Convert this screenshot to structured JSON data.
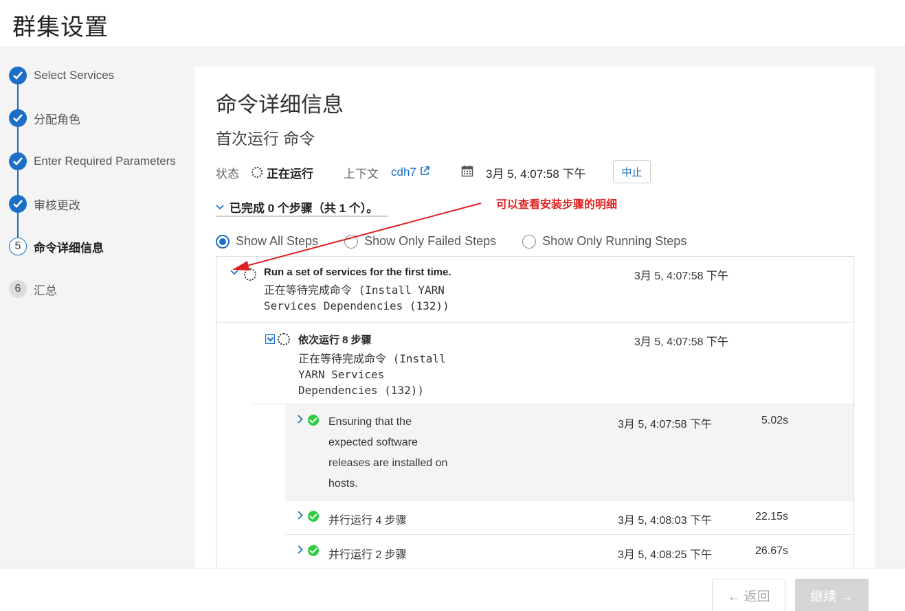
{
  "page_title": "群集设置",
  "wizard": {
    "steps": [
      {
        "label": "Select Services",
        "state": "done",
        "marker": ""
      },
      {
        "label": "分配角色",
        "state": "done",
        "marker": ""
      },
      {
        "label": "Enter Required Parameters",
        "state": "done",
        "marker": ""
      },
      {
        "label": "审核更改",
        "state": "done",
        "marker": ""
      },
      {
        "label": "命令详细信息",
        "state": "current",
        "marker": "5"
      },
      {
        "label": "汇总",
        "state": "todo",
        "marker": "6"
      }
    ]
  },
  "panel": {
    "title": "命令详细信息",
    "subtitle": "首次运行 命令",
    "status_label": "状态",
    "status_value": "正在运行",
    "context_label": "上下文",
    "context_link": "cdh7",
    "start_time": "3月 5, 4:07:58 下午",
    "abort_label": "中止",
    "summary": "已完成 0 个步骤（共 1 个）。",
    "filters": [
      {
        "label": "Show All Steps",
        "checked": true
      },
      {
        "label": "Show Only Failed Steps",
        "checked": false
      },
      {
        "label": "Show Only Running Steps",
        "checked": false
      }
    ]
  },
  "steps": {
    "root": {
      "title": "Run a set of services for the first time.",
      "msg_line1": "正在等待完成命令 (Install YARN",
      "msg_line2": "Services Dependencies (132))",
      "time": "3月 5, 4:07:58 下午"
    },
    "child": {
      "title": "依次运行 8 步骤",
      "msg_line1": "正在等待完成命令 (Install",
      "msg_line2": "YARN Services",
      "msg_line3": "Dependencies (132))",
      "time": "3月 5, 4:07:58 下午"
    },
    "items": [
      {
        "line1": "Ensuring that the",
        "line2": "expected software",
        "line3": "releases are installed on",
        "line4": "hosts.",
        "time": "3月 5, 4:07:58 下午",
        "duration": "5.02s"
      },
      {
        "line1": "并行运行 4 步骤",
        "time": "3月 5, 4:08:03 下午",
        "duration": "22.15s"
      },
      {
        "line1": "并行运行 2 步骤",
        "time": "3月 5, 4:08:25 下午",
        "duration": "26.67s"
      }
    ]
  },
  "annotation": "可以查看安装步骤的明细",
  "footer": {
    "back_label": "← 返回",
    "next_label": "继续 →"
  },
  "colors": {
    "accent": "#1b6fc8",
    "success": "#2ecc40",
    "annotation": "#e02020"
  }
}
